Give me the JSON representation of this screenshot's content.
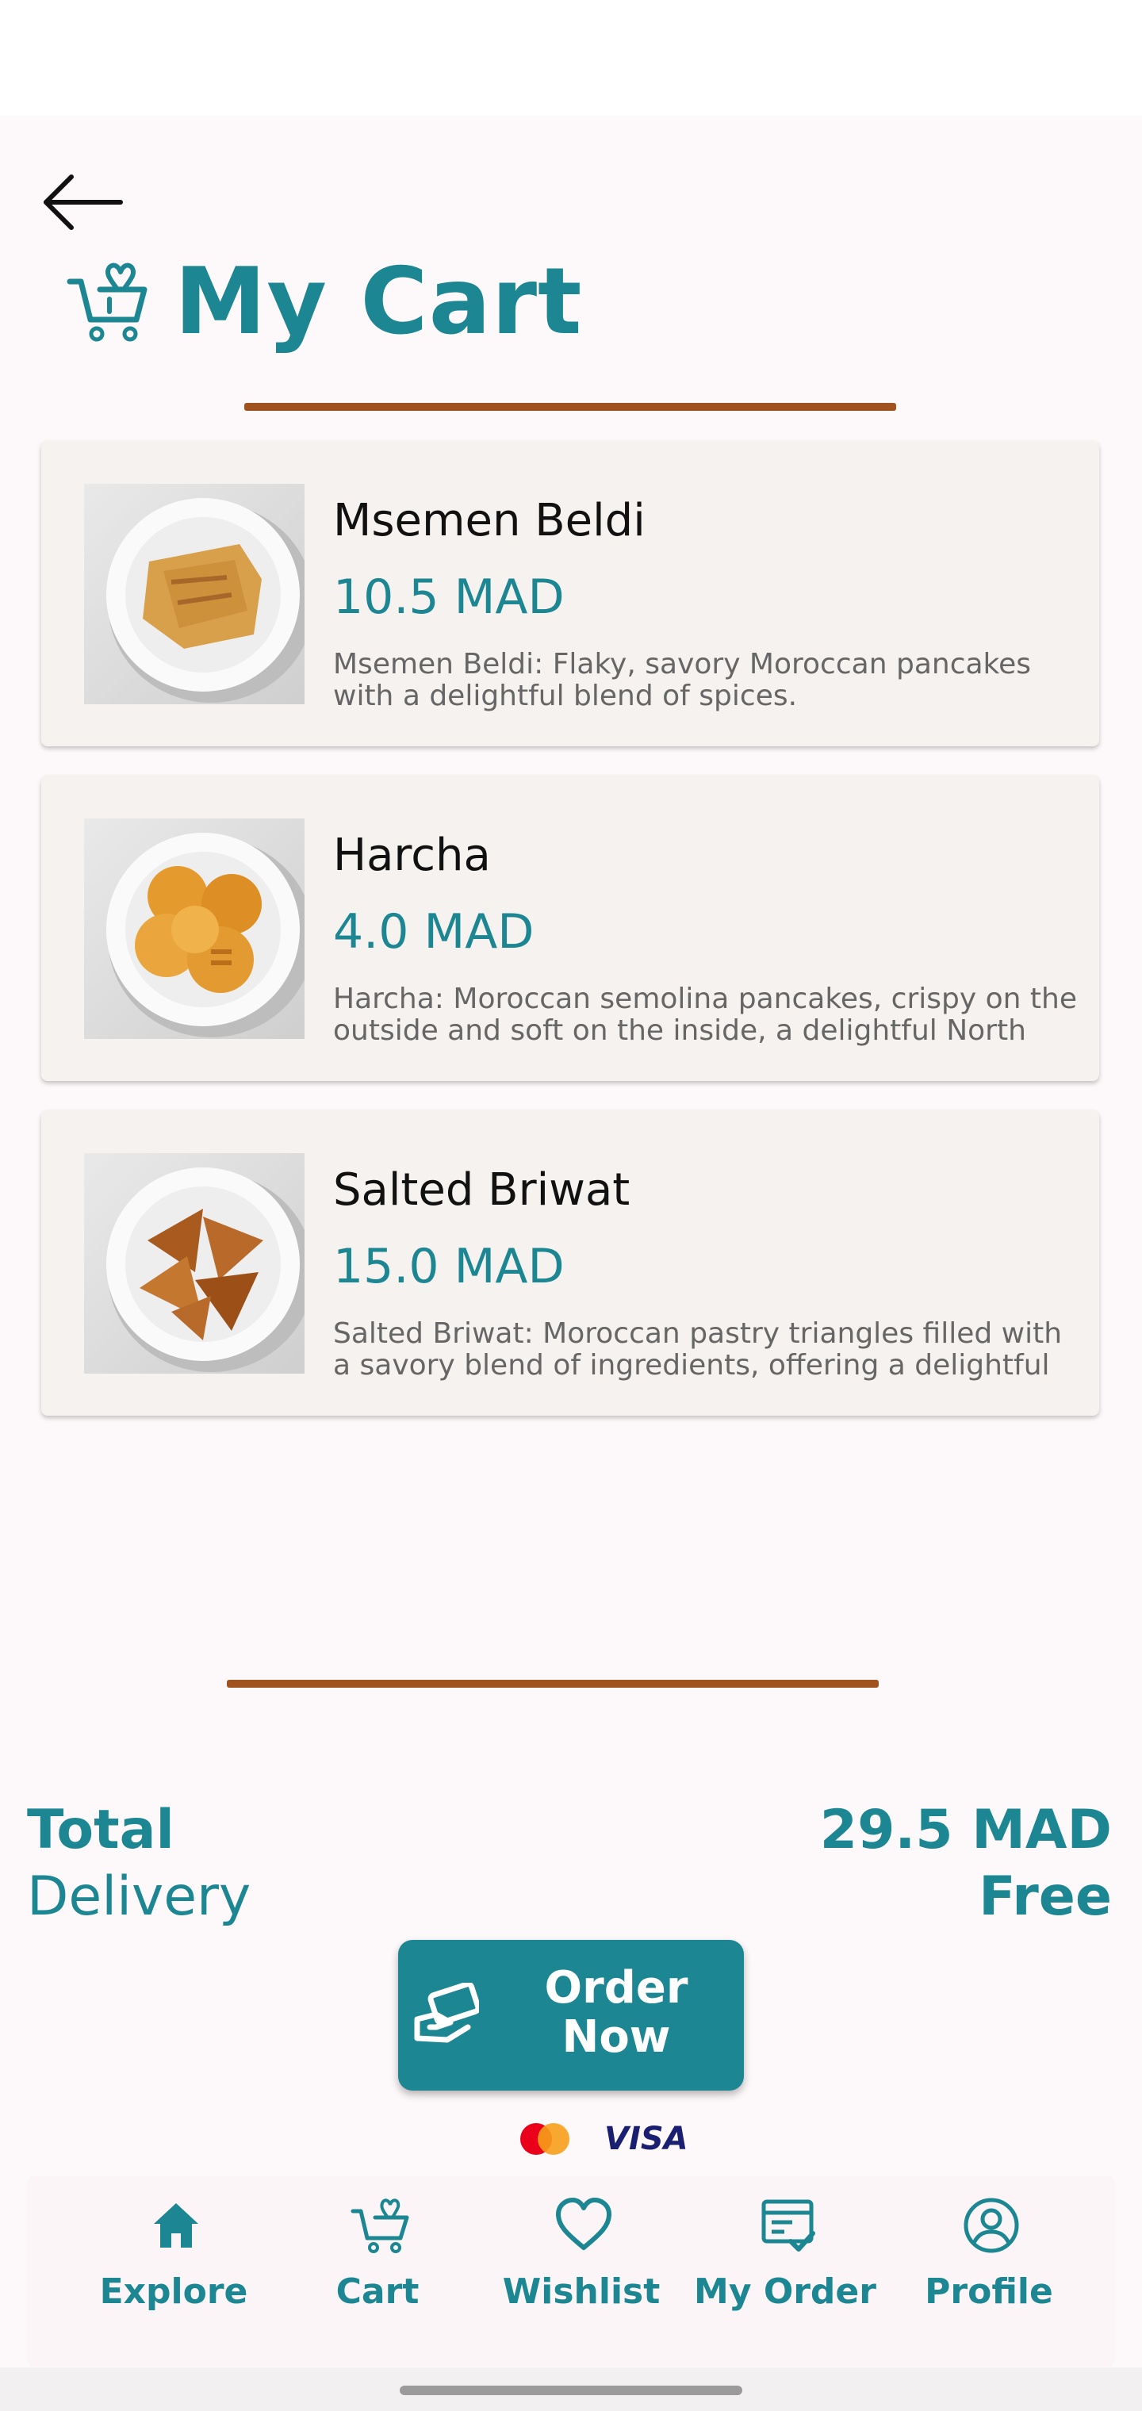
{
  "header": {
    "title": "My Cart"
  },
  "cart": {
    "items": [
      {
        "name": "Msemen Beldi",
        "price": "10.5 MAD",
        "description": "Msemen Beldi: Flaky, savory Moroccan pancakes with a delightful blend of spices."
      },
      {
        "name": "Harcha",
        "price": "4.0 MAD",
        "description": "Harcha: Moroccan semolina pancakes, crispy on the outside and soft on the inside, a delightful North"
      },
      {
        "name": "Salted Briwat",
        "price": "15.0 MAD",
        "description": "Salted Briwat: Moroccan pastry triangles filled with a savory blend of ingredients, offering a delightful"
      }
    ]
  },
  "summary": {
    "total_label": "Total",
    "total_value": "29.5 MAD",
    "delivery_label": "Delivery",
    "delivery_value": "Free"
  },
  "order_button": {
    "label": "Order Now"
  },
  "payment": {
    "visa_label": "VISA"
  },
  "nav": {
    "items": [
      {
        "label": "Explore",
        "icon": "home-icon"
      },
      {
        "label": "Cart",
        "icon": "cart-icon"
      },
      {
        "label": "Wishlist",
        "icon": "heart-icon"
      },
      {
        "label": "My Order",
        "icon": "order-icon"
      },
      {
        "label": "Profile",
        "icon": "profile-icon"
      }
    ]
  },
  "colors": {
    "accent": "#1c8793",
    "divider": "#a0531f",
    "card_bg": "#f6f2ef",
    "page_bg": "#fdf8fa"
  }
}
